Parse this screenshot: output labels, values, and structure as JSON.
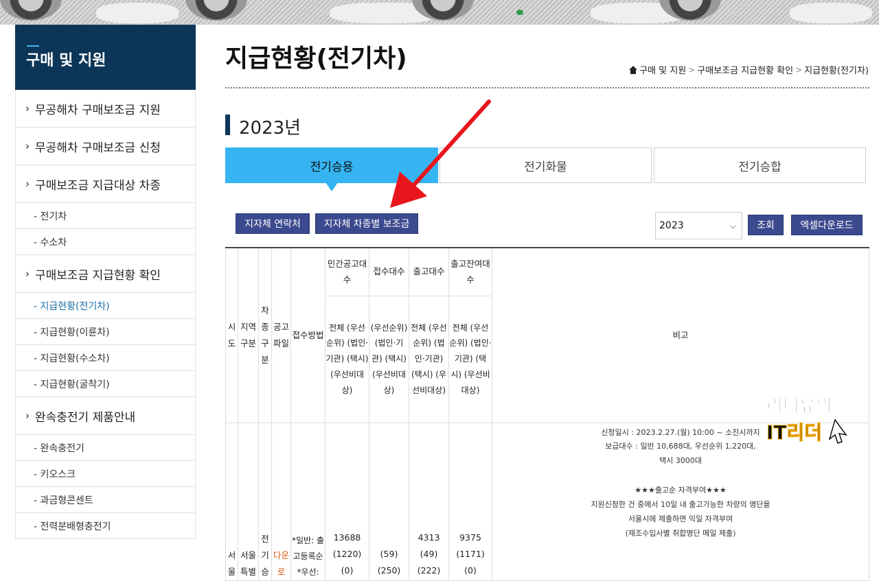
{
  "sidebar": {
    "title": "구매 및 지원",
    "items": [
      {
        "label": "무공해차 구매보조금 지원",
        "type": "main"
      },
      {
        "label": "무공해차 구매보조금 신청",
        "type": "main"
      },
      {
        "label": "구매보조금 지급대상 차종",
        "type": "main"
      },
      {
        "label": "- 전기차",
        "type": "sub"
      },
      {
        "label": "- 수소차",
        "type": "sub"
      },
      {
        "label": "구매보조금 지급현황 확인",
        "type": "main"
      },
      {
        "label": "- 지급현황(전기차)",
        "type": "sub-active"
      },
      {
        "label": "- 지급현황(이륜차)",
        "type": "sub"
      },
      {
        "label": "- 지급현황(수소차)",
        "type": "sub"
      },
      {
        "label": "- 지급현황(굴착기)",
        "type": "sub"
      },
      {
        "label": "완속충전기 제품안내",
        "type": "main"
      },
      {
        "label": "- 완속충전기",
        "type": "sub"
      },
      {
        "label": "- 키오스크",
        "type": "sub"
      },
      {
        "label": "- 과금형콘센트",
        "type": "sub"
      },
      {
        "label": "- 전력분배형충전기",
        "type": "sub"
      }
    ]
  },
  "page": {
    "title": "지급현황(전기차)",
    "breadcrumb": [
      "구매 및 지원",
      "구매보조금 지급현황 확인",
      "지급현황(전기차)"
    ],
    "year": "2023년"
  },
  "tabs": [
    "전기승용",
    "전기화물",
    "전기승합"
  ],
  "buttons": {
    "contacts": "지자체 연락처",
    "subsidy": "지자체 차종별 보조금",
    "search": "조회",
    "excel": "엑셀다운로드"
  },
  "select": {
    "value": "2023"
  },
  "table": {
    "headers": {
      "sido": "시도",
      "region": "지역구분",
      "car_type": "차종구분",
      "file": "공고파일",
      "method": "접수방법",
      "private_notice": "민간공고대수",
      "received": "접수대수",
      "released": "출고대수",
      "remaining": "출고잔여대수",
      "sub_label": "전체 (우선순위) (법인·기관) (택시) (우선비대상)",
      "sub_label_alt": "(우선순위) (법인·기관) (택시) (우선비대상)",
      "remarks": "비고"
    },
    "row": {
      "sido": "서울",
      "region": "서울특별",
      "car_type": "전기승",
      "file": "다운로",
      "method": "*일반: 출고등록순 *우선:",
      "private_notice": [
        "13688",
        "(1220)",
        "(0)"
      ],
      "received": [
        "",
        "(59)",
        "(250)"
      ],
      "released": [
        "4313",
        "(49)",
        "(222)"
      ],
      "remaining": [
        "9375",
        "(1171)",
        "(0)"
      ],
      "remarks": [
        "신청일시 : 2023.2.27.(월) 10:00 ~ 소진시까지",
        "보급대수 : 일반 10,688대, 우선순위 1,220대,",
        "택시 3000대",
        "",
        "★★★출고순 자격부여★★★",
        "지원신청한 건 중에서 10일 내 출고가능한 차량의 명단을",
        "서울시에 제출하면 익일 자격부여",
        "(제조수입사별 취합명단 메일 제출)"
      ]
    }
  },
  "watermark": {
    "line1": "리더유의",
    "line2": "IT리더"
  },
  "colors": {
    "navy": "#0d3558",
    "active_tab": "#35b4f1",
    "button": "#3b4a8e",
    "arrow": "#e8161c"
  }
}
